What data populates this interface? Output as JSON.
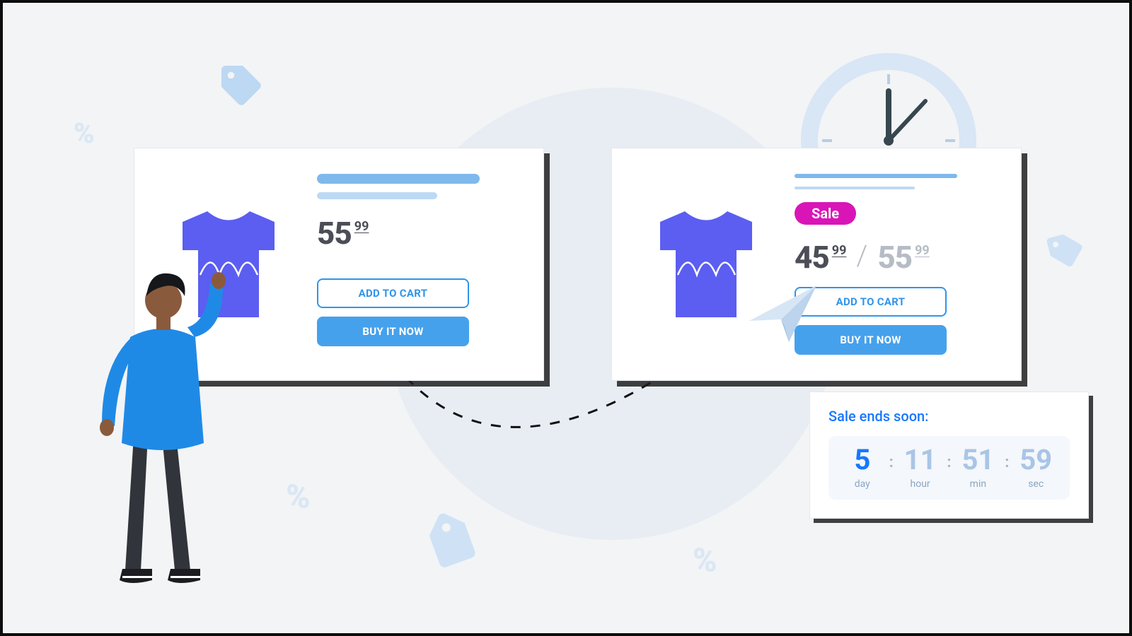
{
  "left_card": {
    "price_main": "55",
    "price_cents": "99",
    "btn_add": "ADD TO CART",
    "btn_buy": "BUY IT NOW"
  },
  "right_card": {
    "sale_label": "Sale",
    "sale_price_main": "45",
    "sale_price_cents": "99",
    "orig_price_main": "55",
    "orig_price_cents": "99",
    "btn_add": "ADD TO CART",
    "btn_buy": "BUY IT NOW"
  },
  "countdown": {
    "title": "Sale ends soon:",
    "day_num": "5",
    "day_label": "day",
    "hour_num": "11",
    "hour_label": "hour",
    "min_num": "51",
    "min_label": "min",
    "sec_num": "59",
    "sec_label": "sec"
  }
}
